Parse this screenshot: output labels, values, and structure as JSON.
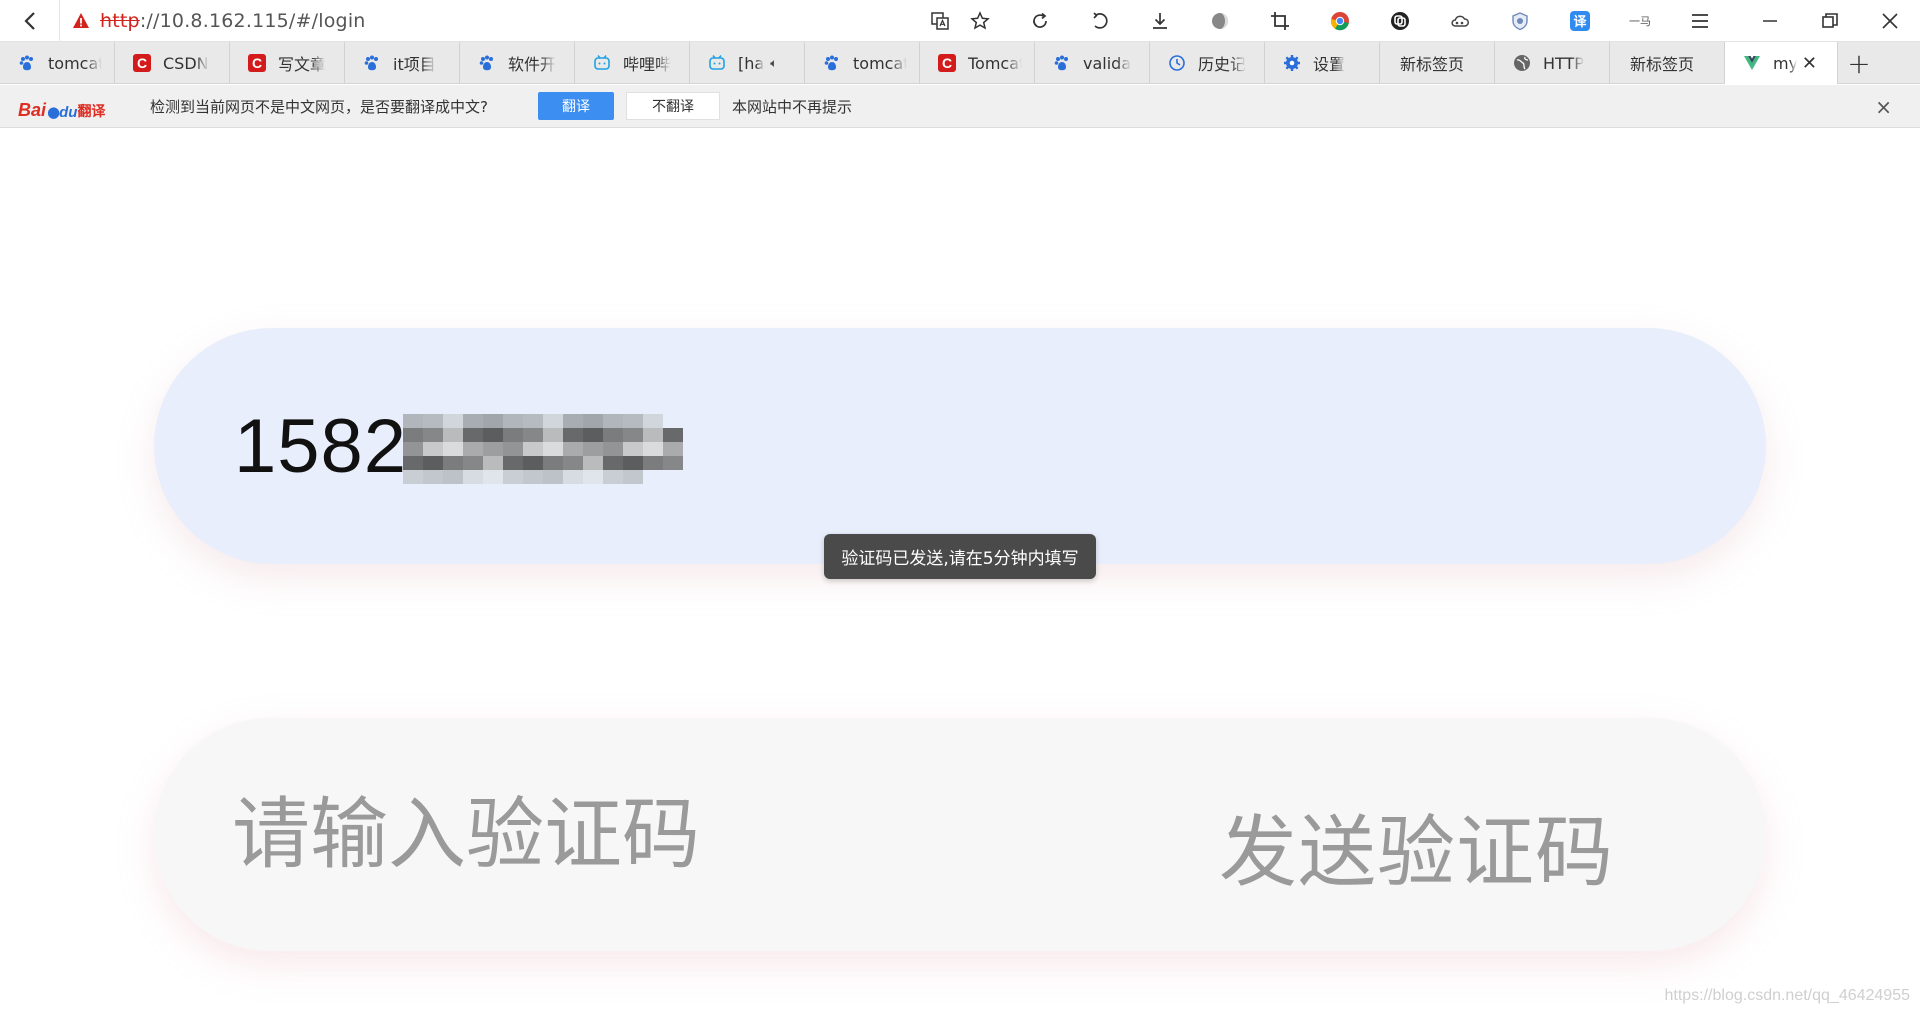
{
  "browser": {
    "url_protocol": "http",
    "url_rest": "://10.8.162.115/#/login",
    "ext_translate_label": "译",
    "ext_text_label": "一马",
    "tabs": [
      {
        "label": "tomcat",
        "icon": "baidu-paw-icon"
      },
      {
        "label": "CSDN",
        "icon": "csdn-icon"
      },
      {
        "label": "写文章",
        "icon": "csdn-icon"
      },
      {
        "label": "it项目",
        "icon": "baidu-paw-icon"
      },
      {
        "label": "软件开",
        "icon": "baidu-paw-icon"
      },
      {
        "label": "哔哩哔",
        "icon": "bilibili-icon"
      },
      {
        "label": "[ha",
        "icon": "bilibili-icon"
      },
      {
        "label": "tomcat",
        "icon": "baidu-paw-icon"
      },
      {
        "label": "Tomcat",
        "icon": "csdn-icon"
      },
      {
        "label": "valida",
        "icon": "baidu-paw-icon"
      },
      {
        "label": "历史记",
        "icon": "history-icon"
      },
      {
        "label": "设置",
        "icon": "gear-icon"
      },
      {
        "label": "新标签页",
        "icon": ""
      },
      {
        "label": "HTTP",
        "icon": "globe-icon"
      },
      {
        "label": "新标签页",
        "icon": ""
      },
      {
        "label": "my",
        "icon": "vue-icon",
        "active": true
      }
    ],
    "new_tab_label": "+"
  },
  "translate_bar": {
    "logo_bai": "Bai",
    "logo_du": "du",
    "logo_fanyi": "翻译",
    "message": "检测到当前网页不是中文网页，是否要翻译成中文?",
    "translate_button": "翻译",
    "no_translate_button": "不翻译",
    "never_link": "本网站中不再提示",
    "close": "×"
  },
  "login": {
    "phone_value": "1582",
    "toast": "验证码已发送,请在5分钟内填写",
    "code_placeholder": "请输入验证码",
    "send_code_button": "发送验证码"
  },
  "watermark": "https://blog.csdn.net/qq_46424955"
}
